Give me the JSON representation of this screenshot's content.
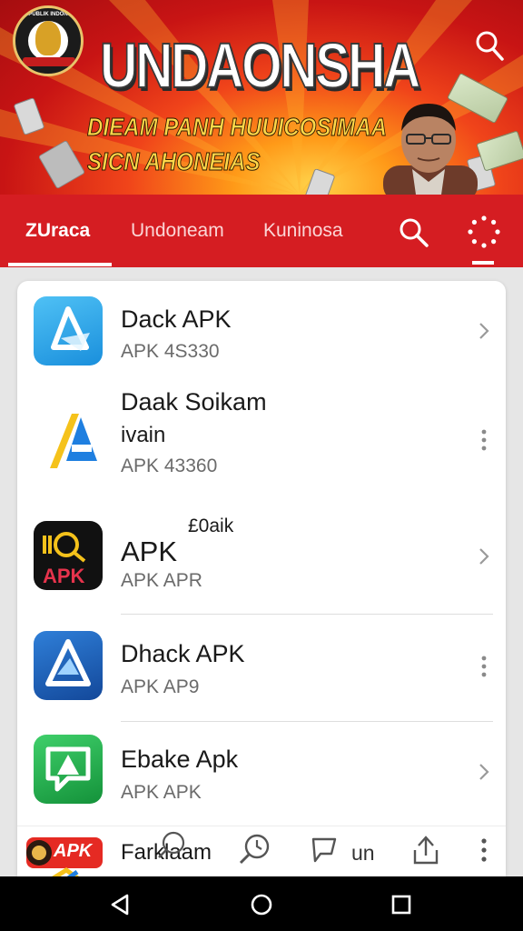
{
  "banner": {
    "title": "UNDAONSHA",
    "subtitle_line1": "DIEAM PANH HUUICOSIMAA",
    "subtitle_line2": "SICN AHONEIAS",
    "emblem_text": "REPUBLIK INDONESIA"
  },
  "tabs": [
    {
      "label": "ZUraca",
      "active": true
    },
    {
      "label": "Undoneam",
      "active": false
    },
    {
      "label": "Kuninosa",
      "active": false
    }
  ],
  "apps": [
    {
      "title": "Dack APK",
      "subtitle": "APK 4S330",
      "action": "chevron",
      "icon": "a-triangle-icon"
    },
    {
      "title": "Daak Soikam",
      "extra": "ivain",
      "subtitle": "APK 43360",
      "action": "kebab",
      "icon": "a-letter-icon"
    },
    {
      "title": "APK",
      "title_sup": "£0aik",
      "subtitle": "APK APR",
      "action": "chevron",
      "icon": "apk-search-icon"
    },
    {
      "title": "Dhack APK",
      "subtitle": "APK AP9",
      "action": "kebab",
      "icon": "a-triangle-icon"
    },
    {
      "title": "Ebake Apk",
      "subtitle": "APK APK",
      "action": "chevron",
      "icon": "a-chat-icon"
    }
  ],
  "bottom_bar": {
    "logo_text": "APK",
    "label": "Farklaam",
    "button_text": "un"
  },
  "colors": {
    "nav_red": "#d51d22",
    "banner_red": "#c81414",
    "banner_yellow": "#ffd84a"
  }
}
